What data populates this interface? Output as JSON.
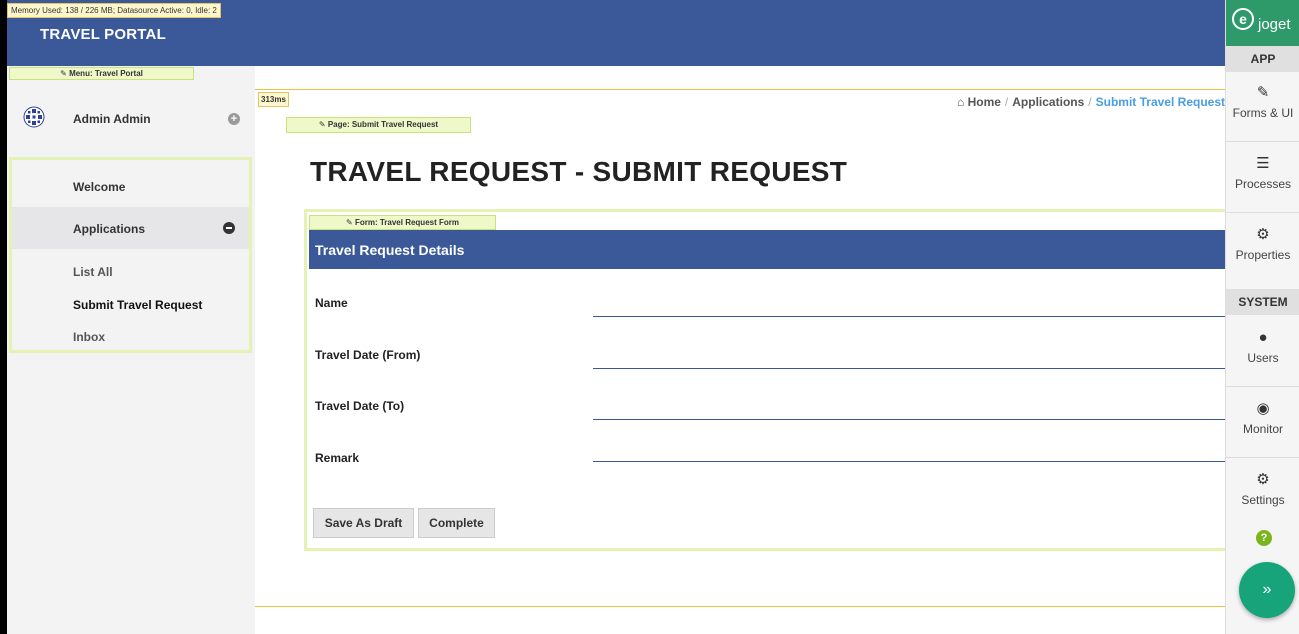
{
  "header": {
    "memory": "Memory Used: 138 / 226 MB; Datasource Active: 0, Idle: 2",
    "brand": "TRAVEL PORTAL"
  },
  "sidebar": {
    "menu_tag": "Menu: Travel Portal",
    "user_name": "Admin Admin",
    "items": [
      {
        "label": "Welcome"
      },
      {
        "label": "Applications"
      }
    ],
    "sub_items": [
      {
        "label": "List All"
      },
      {
        "label": "Submit Travel Request"
      },
      {
        "label": "Inbox"
      }
    ]
  },
  "main": {
    "timer": "313ms",
    "page_tag": "Page: Submit Travel Request",
    "breadcrumb": {
      "home": "Home",
      "applications": "Applications",
      "current": "Submit Travel Request"
    },
    "title": "TRAVEL REQUEST - SUBMIT REQUEST"
  },
  "form": {
    "tag": "Form: Travel Request Form",
    "section_title": "Travel Request Details",
    "fields": [
      {
        "label": "Name"
      },
      {
        "label": "Travel Date (From)"
      },
      {
        "label": "Travel Date (To)"
      },
      {
        "label": "Remark"
      }
    ],
    "buttons": {
      "save_draft": "Save As Draft",
      "complete": "Complete"
    }
  },
  "panel": {
    "logo_word": "joget",
    "app_header": "APP",
    "system_header": "SYSTEM",
    "items": {
      "forms": "Forms & UI",
      "processes": "Processes",
      "properties": "Properties",
      "users": "Users",
      "monitor": "Monitor",
      "settings": "Settings"
    },
    "help": "?",
    "expand": "»"
  },
  "colors": {
    "header_blue": "#3b5998",
    "joget_green": "#2e9a6a",
    "tag_bg": "#eef8c9",
    "accent_link": "#4a9de0"
  }
}
